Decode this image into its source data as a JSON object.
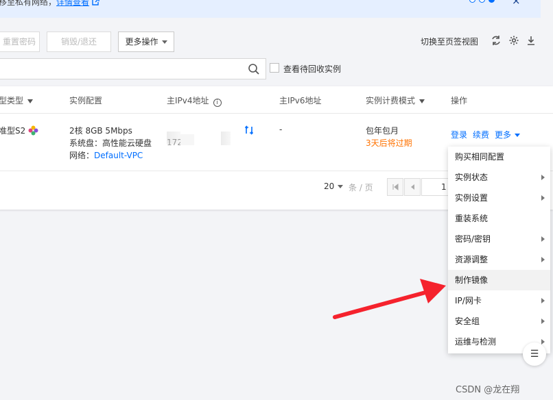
{
  "banner": {
    "text": "移至私有网络，",
    "link": "详情查看",
    "close": "×"
  },
  "toolbar": {
    "reset_password": "重置密码",
    "destroy_return": "销毁/退还",
    "more_actions": "更多操作",
    "switch_view": "切换至页签视图",
    "icons": [
      "refresh-icon",
      "gear-icon",
      "download-icon"
    ]
  },
  "search": {
    "placeholder": "",
    "icon": "search-icon",
    "recycle_label": "查看待回收实例"
  },
  "table": {
    "headers": {
      "type": "型类型",
      "config": "实例配置",
      "ipv4": "主IPv4地址",
      "ipv6": "主IPv6地址",
      "billing": "实例计费模式",
      "ops": "操作"
    },
    "row": {
      "type": "准型S2",
      "config_line1": "2核 8GB 5Mbps",
      "config_line2": "系统盘：高性能云硬盘",
      "network_label": "网络：",
      "network_link": "Default-VPC",
      "ipv4_partial": "172",
      "ipv6": "-",
      "billing_mode": "包年包月",
      "expire": "3天后将过期",
      "op_login": "登录",
      "op_renew": "续费",
      "op_more": "更多"
    }
  },
  "pager": {
    "size": "20",
    "unit": "条 / 页",
    "page": "1"
  },
  "menu": {
    "items": [
      {
        "label": "购买相同配置",
        "sub": false
      },
      {
        "label": "实例状态",
        "sub": true
      },
      {
        "label": "实例设置",
        "sub": true
      },
      {
        "label": "重装系统",
        "sub": false
      },
      {
        "label": "密码/密钥",
        "sub": true
      },
      {
        "label": "资源调整",
        "sub": true
      },
      {
        "label": "制作镜像",
        "sub": false
      },
      {
        "label": "IP/网卡",
        "sub": true
      },
      {
        "label": "安全组",
        "sub": true
      },
      {
        "label": "运维与检测",
        "sub": true
      }
    ]
  },
  "float_button": "☰",
  "watermark": "CSDN @龙在翔",
  "colors": {
    "accent": "#006eff",
    "warning": "#ff7200",
    "arrow": "#f5222d"
  }
}
